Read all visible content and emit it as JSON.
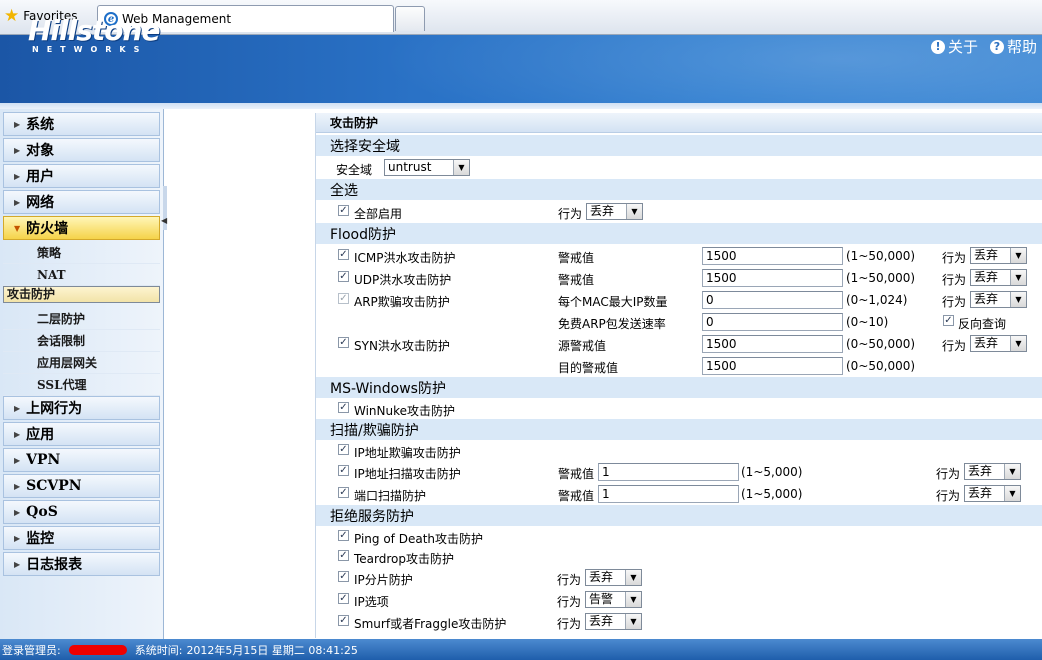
{
  "browser": {
    "favorites_label": "Favorites",
    "tab_title": "Web Management"
  },
  "header": {
    "logo": "Hillstone",
    "logo_sub": "NETWORKS",
    "about": "关于",
    "help": "帮助"
  },
  "sidebar": {
    "items": [
      {
        "label": "系统"
      },
      {
        "label": "对象"
      },
      {
        "label": "用户"
      },
      {
        "label": "网络"
      },
      {
        "label": "防火墙"
      },
      {
        "label": "上网行为"
      },
      {
        "label": "应用"
      },
      {
        "label": "VPN"
      },
      {
        "label": "SCVPN"
      },
      {
        "label": "QoS"
      },
      {
        "label": "监控"
      },
      {
        "label": "日志报表"
      }
    ],
    "firewall_subitems": [
      {
        "label": "策略"
      },
      {
        "label": "NAT"
      },
      {
        "label": "攻击防护"
      },
      {
        "label": "二层防护"
      },
      {
        "label": "会话限制"
      },
      {
        "label": "应用层网关"
      },
      {
        "label": "SSL代理"
      }
    ]
  },
  "panel": {
    "title": "攻击防护",
    "zone_section": "选择安全域",
    "zone_label": "安全域",
    "zone_value": "untrust",
    "select_all_section": "全选",
    "enable_all": "全部启用",
    "action_label": "行为",
    "action_drop": "丢弃",
    "action_alarm": "告警",
    "flood_section": "Flood防护",
    "icmp": "ICMP洪水攻击防护",
    "udp": "UDP洪水攻击防护",
    "arp": "ARP欺骗攻击防护",
    "syn": "SYN洪水攻击防护",
    "threshold": "警戒值",
    "max_ip_per_mac": "每个MAC最大IP数量",
    "free_arp_rate": "免费ARP包发送速率",
    "src_threshold": "源警戒值",
    "dst_threshold": "目的警戒值",
    "reverse_query": "反向查询",
    "icmp_value": "1500",
    "udp_value": "1500",
    "arp_max_ip_value": "0",
    "free_arp_value": "0",
    "syn_src_value": "1500",
    "syn_dst_value": "1500",
    "range_50000": "(1~50,000)",
    "range_1024": "(0~1,024)",
    "range_10": "(0~10)",
    "range_50000_zero": "(0~50,000)",
    "mswin_section": "MS-Windows防护",
    "winnuke": "WinNuke攻击防护",
    "scan_section": "扫描/欺骗防护",
    "ip_spoof": "IP地址欺骗攻击防护",
    "ip_scan": "IP地址扫描攻击防护",
    "port_scan": "端口扫描防护",
    "scan_value": "1",
    "range_5000": "(1~5,000)",
    "dos_section": "拒绝服务防护",
    "ping_death": "Ping of Death攻击防护",
    "teardrop": "Teardrop攻击防护",
    "ip_frag": "IP分片防护",
    "ip_option": "IP选项",
    "smurf": "Smurf或者Fraggle攻击防护"
  },
  "status": {
    "admin_label": "登录管理员:",
    "systime_label": "系统时间:",
    "systime_value": "2012年5月15日 星期二 08:41:25"
  }
}
